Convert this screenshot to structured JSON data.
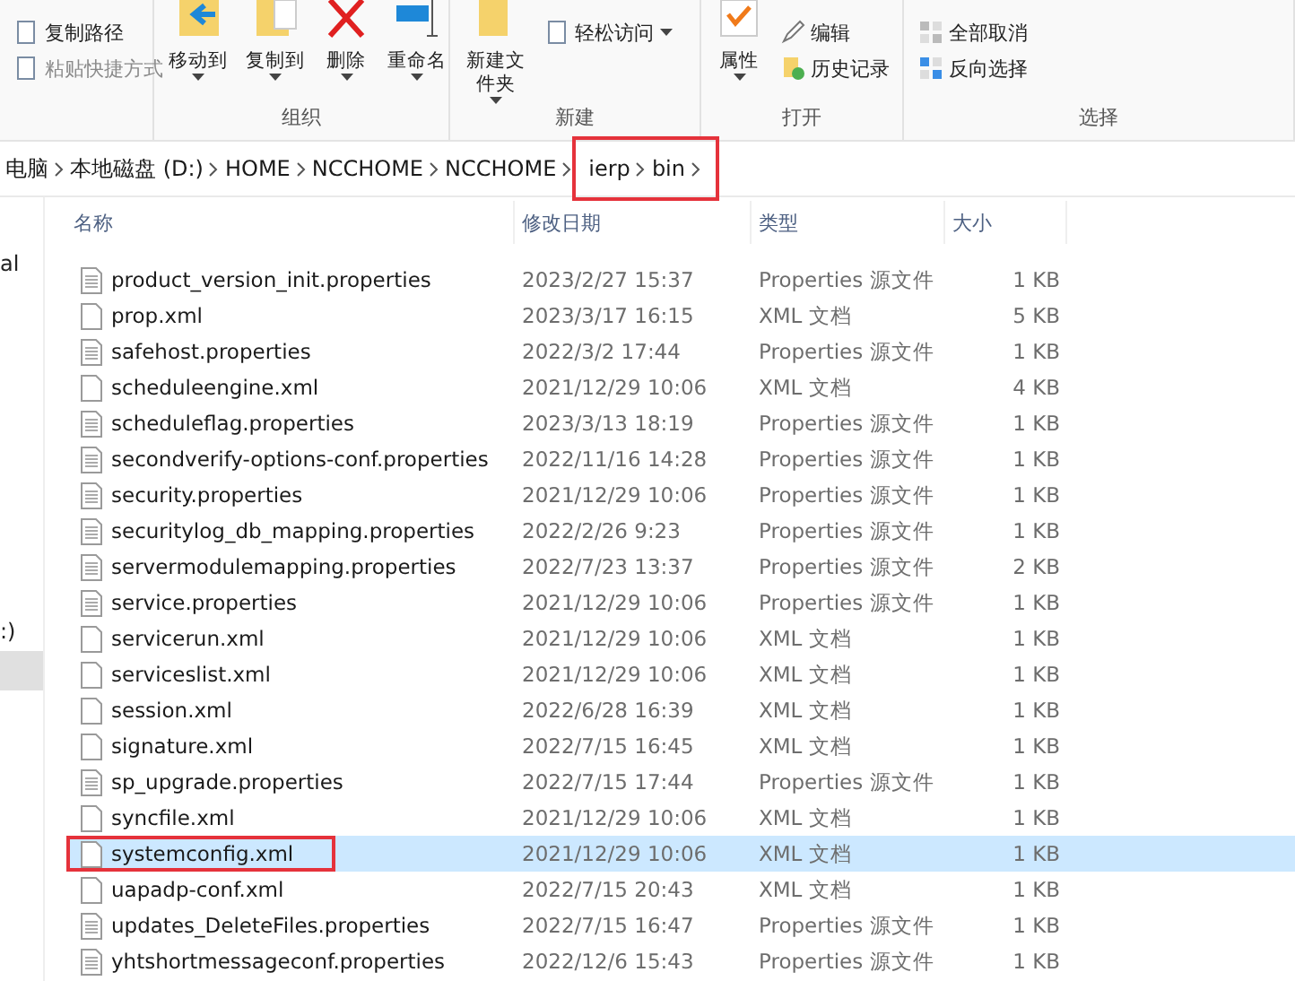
{
  "ribbon": {
    "groups": [
      {
        "small": [
          {
            "label": "复制路径",
            "disabled": false
          },
          {
            "label": "粘贴快捷方式",
            "disabled": true
          }
        ]
      },
      {
        "label": "组织",
        "big": [
          "移动到",
          "复制到",
          "删除",
          "重命名"
        ]
      },
      {
        "label": "新建",
        "big": [
          "新建文件夹"
        ],
        "small": [
          {
            "label": "轻松访问",
            "dropdown": true
          }
        ]
      },
      {
        "label": "打开",
        "big": [
          "属性"
        ],
        "small": [
          {
            "label": "编辑"
          },
          {
            "label": "历史记录"
          }
        ]
      },
      {
        "label": "选择",
        "small": [
          {
            "label": "全部取消"
          },
          {
            "label": "反向选择"
          }
        ]
      }
    ]
  },
  "breadcrumb": [
    {
      "label": "电脑",
      "highlighted": false
    },
    {
      "label": "本地磁盘 (D:)",
      "highlighted": false
    },
    {
      "label": "HOME",
      "highlighted": false
    },
    {
      "label": "NCCHOME",
      "highlighted": false
    },
    {
      "label": "NCCHOME",
      "highlighted": false
    },
    {
      "label": "ierp",
      "highlighted": true
    },
    {
      "label": "bin",
      "highlighted": true
    }
  ],
  "sidebar": {
    "items": [
      {
        "label": "al",
        "selected": false
      },
      {
        "label": ":)",
        "selected": false
      },
      {
        "selected": true
      }
    ]
  },
  "table": {
    "columns": [
      "名称",
      "修改日期",
      "类型",
      "大小"
    ],
    "rows": [
      {
        "name": "product_version_init.properties",
        "date": "2023/2/27 15:37",
        "type": "Properties 源文件",
        "size": "1 KB",
        "kind": "properties",
        "selected": false,
        "highlighted": false
      },
      {
        "name": "prop.xml",
        "date": "2023/3/17 16:15",
        "type": "XML 文档",
        "size": "5 KB",
        "kind": "xml",
        "selected": false,
        "highlighted": false
      },
      {
        "name": "safehost.properties",
        "date": "2022/3/2 17:44",
        "type": "Properties 源文件",
        "size": "1 KB",
        "kind": "properties",
        "selected": false,
        "highlighted": false
      },
      {
        "name": "scheduleengine.xml",
        "date": "2021/12/29 10:06",
        "type": "XML 文档",
        "size": "4 KB",
        "kind": "xml",
        "selected": false,
        "highlighted": false
      },
      {
        "name": "scheduleflag.properties",
        "date": "2023/3/13 18:19",
        "type": "Properties 源文件",
        "size": "1 KB",
        "kind": "properties",
        "selected": false,
        "highlighted": false
      },
      {
        "name": "secondverify-options-conf.properties",
        "date": "2022/11/16 14:28",
        "type": "Properties 源文件",
        "size": "1 KB",
        "kind": "properties",
        "selected": false,
        "highlighted": false
      },
      {
        "name": "security.properties",
        "date": "2021/12/29 10:06",
        "type": "Properties 源文件",
        "size": "1 KB",
        "kind": "properties",
        "selected": false,
        "highlighted": false
      },
      {
        "name": "securitylog_db_mapping.properties",
        "date": "2022/2/26 9:23",
        "type": "Properties 源文件",
        "size": "1 KB",
        "kind": "properties",
        "selected": false,
        "highlighted": false
      },
      {
        "name": "servermodulemapping.properties",
        "date": "2022/7/23 13:37",
        "type": "Properties 源文件",
        "size": "2 KB",
        "kind": "properties",
        "selected": false,
        "highlighted": false
      },
      {
        "name": "service.properties",
        "date": "2021/12/29 10:06",
        "type": "Properties 源文件",
        "size": "1 KB",
        "kind": "properties",
        "selected": false,
        "highlighted": false
      },
      {
        "name": "servicerun.xml",
        "date": "2021/12/29 10:06",
        "type": "XML 文档",
        "size": "1 KB",
        "kind": "xml",
        "selected": false,
        "highlighted": false
      },
      {
        "name": "serviceslist.xml",
        "date": "2021/12/29 10:06",
        "type": "XML 文档",
        "size": "1 KB",
        "kind": "xml",
        "selected": false,
        "highlighted": false
      },
      {
        "name": "session.xml",
        "date": "2022/6/28 16:39",
        "type": "XML 文档",
        "size": "1 KB",
        "kind": "xml",
        "selected": false,
        "highlighted": false
      },
      {
        "name": "signature.xml",
        "date": "2022/7/15 16:45",
        "type": "XML 文档",
        "size": "1 KB",
        "kind": "xml",
        "selected": false,
        "highlighted": false
      },
      {
        "name": "sp_upgrade.properties",
        "date": "2022/7/15 17:44",
        "type": "Properties 源文件",
        "size": "1 KB",
        "kind": "properties",
        "selected": false,
        "highlighted": false
      },
      {
        "name": "syncfile.xml",
        "date": "2021/12/29 10:06",
        "type": "XML 文档",
        "size": "1 KB",
        "kind": "xml",
        "selected": false,
        "highlighted": false
      },
      {
        "name": "systemconfig.xml",
        "date": "2021/12/29 10:06",
        "type": "XML 文档",
        "size": "1 KB",
        "kind": "xml",
        "selected": true,
        "highlighted": true
      },
      {
        "name": "uapadp-conf.xml",
        "date": "2022/7/15 20:43",
        "type": "XML 文档",
        "size": "1 KB",
        "kind": "xml",
        "selected": false,
        "highlighted": false
      },
      {
        "name": "updates_DeleteFiles.properties",
        "date": "2022/7/15 16:47",
        "type": "Properties 源文件",
        "size": "1 KB",
        "kind": "properties",
        "selected": false,
        "highlighted": false
      },
      {
        "name": "yhtshortmessageconf.properties",
        "date": "2022/12/6 15:43",
        "type": "Properties 源文件",
        "size": "1 KB",
        "kind": "properties",
        "selected": false,
        "highlighted": false
      }
    ]
  }
}
